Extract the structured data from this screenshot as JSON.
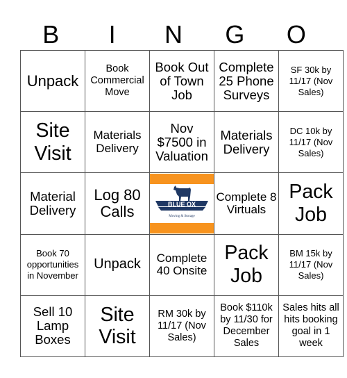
{
  "header": [
    "B",
    "I",
    "N",
    "G",
    "O"
  ],
  "board": [
    [
      {
        "text": "Unpack",
        "size": "s22"
      },
      {
        "text": "Book Commercial Move",
        "size": "s14"
      },
      {
        "text": "Book Out of Town Job",
        "size": "s18"
      },
      {
        "text": "Complete 25 Phone Surveys",
        "size": "s18"
      },
      {
        "text": "SF 30k by 11/17 (Nov Sales)",
        "size": "s13"
      }
    ],
    [
      {
        "text": "Site Visit",
        "size": "s28"
      },
      {
        "text": "Materials Delivery",
        "size": "s17"
      },
      {
        "text": "Nov $7500 in Valuation",
        "size": "s18"
      },
      {
        "text": "Materials Delivery",
        "size": "s18"
      },
      {
        "text": "DC 10k by 11/17 (Nov Sales)",
        "size": "s13"
      }
    ],
    [
      {
        "text": "Material Delivery",
        "size": "s18"
      },
      {
        "text": "Log 80 Calls",
        "size": "s22"
      },
      {
        "free": true,
        "logo": {
          "brand": "BLUE OX",
          "tagline": "Moving & Storage",
          "icon": "ox-icon",
          "colors": {
            "band": "#f7931e",
            "navy": "#1f3864"
          }
        }
      },
      {
        "text": "Complete 8 Virtuals",
        "size": "s17"
      },
      {
        "text": "Pack Job",
        "size": "s28"
      }
    ],
    [
      {
        "text": "Book 70 opportunities in November",
        "size": "s13"
      },
      {
        "text": "Unpack",
        "size": "s20"
      },
      {
        "text": "Complete 40 Onsite",
        "size": "s17"
      },
      {
        "text": "Pack Job",
        "size": "s28"
      },
      {
        "text": "BM 15k by 11/17 (Nov Sales)",
        "size": "s13"
      }
    ],
    [
      {
        "text": "Sell 10 Lamp Boxes",
        "size": "s18"
      },
      {
        "text": "Site Visit",
        "size": "s28"
      },
      {
        "text": "RM 30k by 11/17 (Nov Sales)",
        "size": "s14"
      },
      {
        "text": "Book $110k by 11/30 for December Sales",
        "size": "s14"
      },
      {
        "text": "Sales hits all hits booking goal in 1 week",
        "size": "s14"
      }
    ]
  ]
}
